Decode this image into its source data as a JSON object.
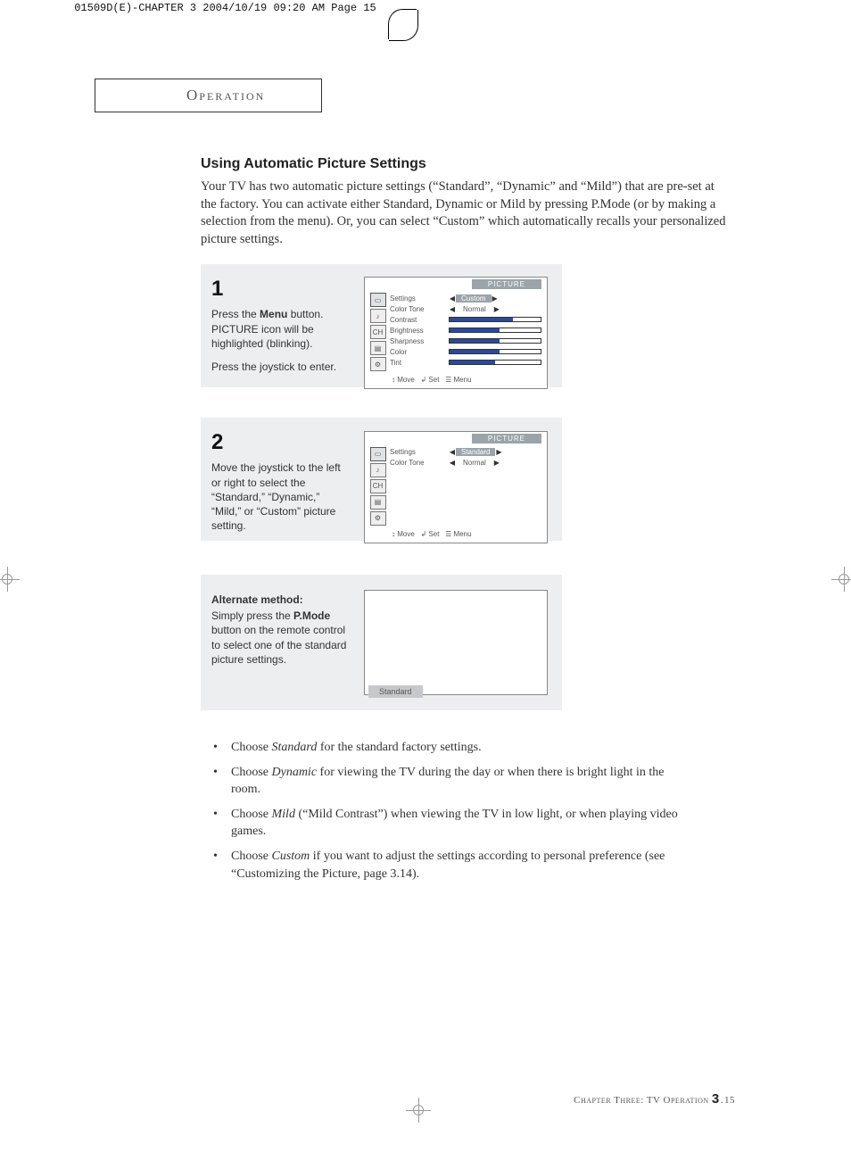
{
  "header_strip": "01509D(E)-CHAPTER 3  2004/10/19  09:20 AM  Page 15",
  "section_title": "Operation",
  "heading": "Using Automatic Picture Settings",
  "intro": "Your TV has two automatic picture settings (“Standard”, “Dynamic” and “Mild”) that are pre-set at the factory.  You can activate either Standard, Dynamic or Mild by pressing P.Mode (or by making a selection from the menu). Or, you can select “Custom” which automatically recalls your personalized picture settings.",
  "step1": {
    "num": "1",
    "p1a": "Press the ",
    "p1b": "Menu",
    "p1c": " button. PICTURE icon will be highlighted (blinking).",
    "p2": "Press the joystick to enter."
  },
  "step2": {
    "num": "2",
    "p1": "Move the joystick to the left or right to select the “Standard,” “Dynamic,” “Mild,” or “Custom” picture setting."
  },
  "alt": {
    "title": "Alternate method:",
    "p_a": "Simply press the ",
    "p_b": "P.Mode",
    "p_c": " button on the remote control to select one of the standard picture settings.",
    "chip": "Standard"
  },
  "osd": {
    "title": "PICTURE",
    "settings": "Settings",
    "colortone": "Color Tone",
    "contrast": "Contrast",
    "brightness": "Brightness",
    "sharpness": "Sharpness",
    "color": "Color",
    "tint": "Tint",
    "custom": "Custom",
    "normal": "Normal",
    "standard": "Standard",
    "foot_move": "Move",
    "foot_set": "Set",
    "foot_menu": "Menu",
    "foot_glyph_updown": "↕",
    "foot_glyph_enter": "↲",
    "foot_glyph_menu": "☰",
    "arrow_l": "◀",
    "arrow_r": "▶"
  },
  "bullets": {
    "b1a": "Choose ",
    "b1i": "Standard",
    "b1b": " for the standard factory settings.",
    "b2a": "Choose ",
    "b2i": "Dynamic",
    "b2b": " for viewing the TV during the day or when there is bright light in the room.",
    "b3a": "Choose ",
    "b3i": "Mild",
    "b3b": " (“Mild Contrast”) when viewing the TV in low light, or when playing video games.",
    "b4a": "Choose ",
    "b4i": "Custom",
    "b4b": " if you want to adjust the settings according to personal preference (see “Customizing the Picture, page 3.14)."
  },
  "footer": {
    "label": "Chapter Three: TV Operation ",
    "page_major": "3",
    "dot": ".",
    "page_minor": "15"
  }
}
